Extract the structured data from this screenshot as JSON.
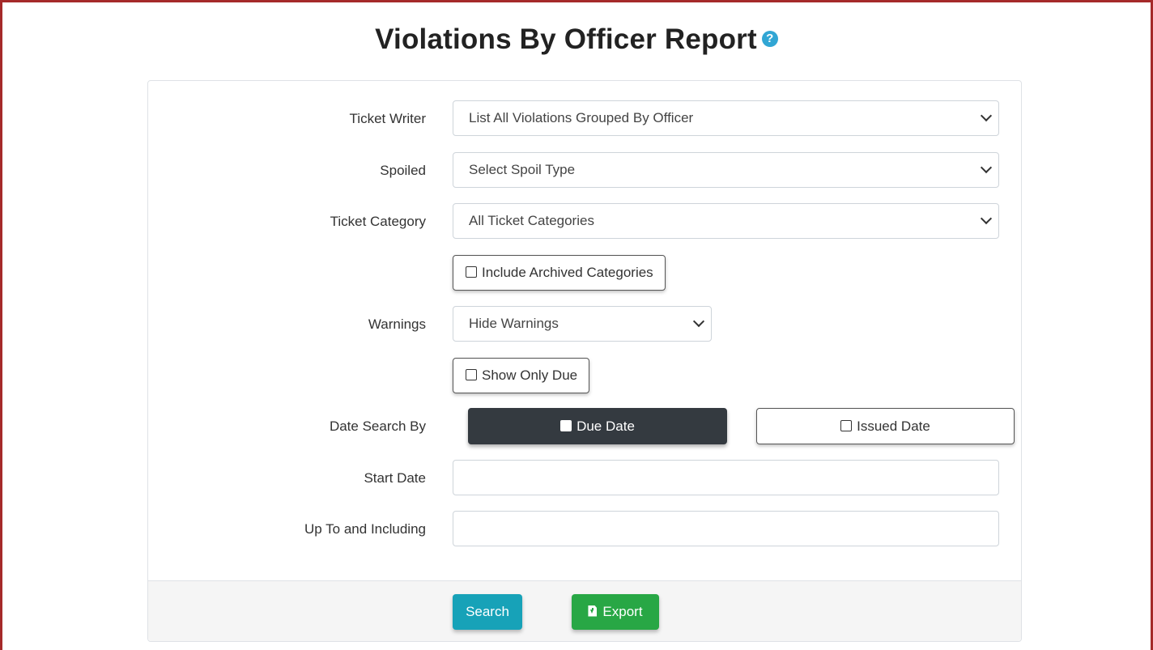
{
  "page": {
    "title": "Violations By Officer Report",
    "help_icon_glyph": "?"
  },
  "form": {
    "ticket_writer": {
      "label": "Ticket Writer",
      "selected": "List All Violations Grouped By Officer"
    },
    "spoiled": {
      "label": "Spoiled",
      "selected": "Select Spoil Type"
    },
    "ticket_category": {
      "label": "Ticket Category",
      "selected": "All Ticket Categories"
    },
    "include_archived": {
      "label": "Include Archived Categories",
      "checked": false
    },
    "warnings": {
      "label": "Warnings",
      "selected": "Hide Warnings"
    },
    "show_only_due": {
      "label": "Show Only Due",
      "checked": false
    },
    "date_search_by": {
      "label": "Date Search By",
      "options": [
        "Due Date",
        "Issued Date"
      ],
      "selected": "Due Date"
    },
    "start_date": {
      "label": "Start Date",
      "value": ""
    },
    "end_date": {
      "label": "Up To and Including",
      "value": ""
    }
  },
  "actions": {
    "search_label": "Search",
    "export_label": "Export"
  },
  "colors": {
    "frame_border": "#a52a2a",
    "help_icon": "#31a6d4",
    "active_segment": "#343a40",
    "search_button": "#17a2b8",
    "export_button": "#28a745"
  }
}
